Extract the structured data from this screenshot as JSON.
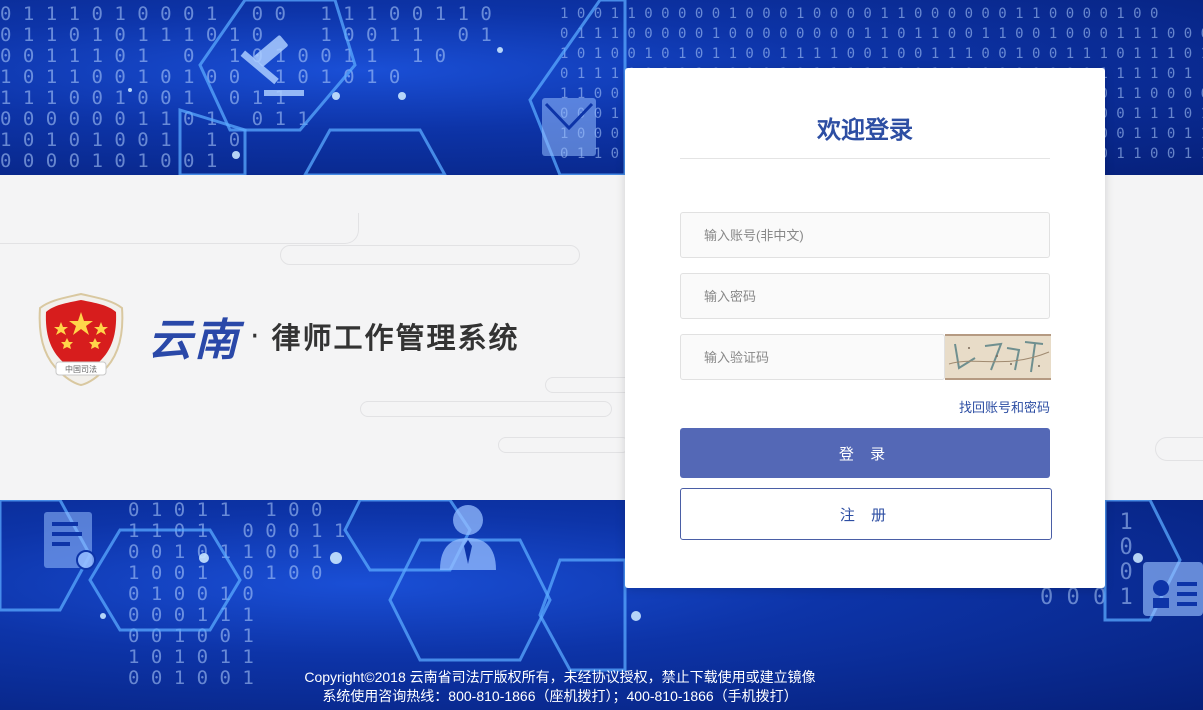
{
  "system": {
    "brand_region": "云南",
    "brand_separator": "·",
    "system_name": "律师工作管理系统",
    "emblem_text": "中国司法"
  },
  "login": {
    "title": "欢迎登录",
    "account_placeholder": "输入账号(非中文)",
    "password_placeholder": "输入密码",
    "captcha_placeholder": "输入验证码",
    "captcha_text": "L7T",
    "forgot_link": "找回账号和密码",
    "login_button": "登 录",
    "register_button": "注 册"
  },
  "footer": {
    "line1": "Copyright©2018 云南省司法厅版权所有，未经协议授权，禁止下载使用或建立镜像",
    "line2": "系统使用咨询热线：800-810-1866（座机拨打）；400-810-1866（手机拨打）"
  },
  "colors": {
    "brand_blue": "#2d4ea3",
    "button_blue": "#5468b6",
    "bg_blue": "#0d34a8",
    "band_grey": "#f4f4f5"
  },
  "icons": [
    "gavel-icon",
    "mail-icon",
    "document-gear-icon",
    "user-icon",
    "id-card-icon",
    "emblem-icon"
  ]
}
